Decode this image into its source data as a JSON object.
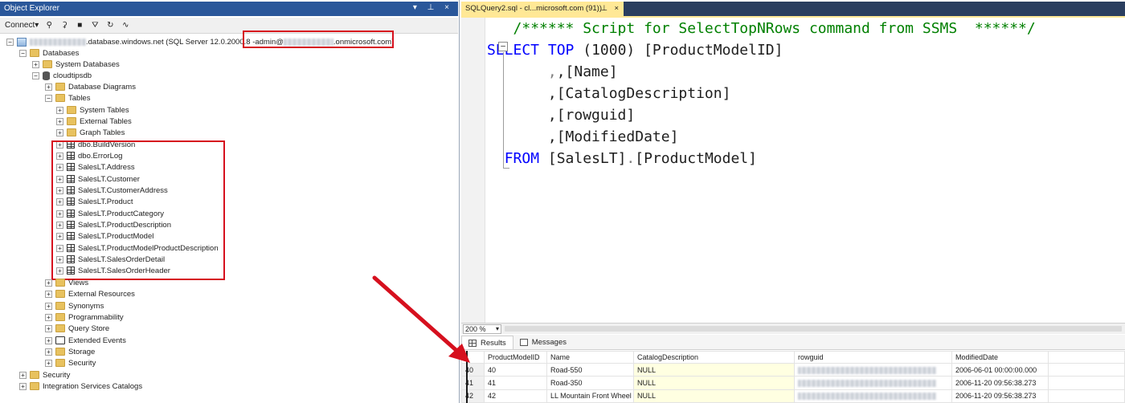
{
  "object_explorer": {
    "title": "Object Explorer",
    "title_buttons": "▾ ⊥ ×",
    "toolbar": {
      "connect_label": "Connect",
      "connect_caret": "▾"
    },
    "server": {
      "name_suffix": ".database.windows.net (SQL Server 12.0.2000.8 - ",
      "user_prefix": "admin@",
      "user_suffix": ".onmicrosoft.com)"
    },
    "databases": "Databases",
    "system_databases": "System Databases",
    "db_name": "cloudtipsdb",
    "database_diagrams": "Database Diagrams",
    "tables": "Tables",
    "table_folders": [
      "System Tables",
      "External Tables",
      "Graph Tables"
    ],
    "table_list": [
      "dbo.BuildVersion",
      "dbo.ErrorLog",
      "SalesLT.Address",
      "SalesLT.Customer",
      "SalesLT.CustomerAddress",
      "SalesLT.Product",
      "SalesLT.ProductCategory",
      "SalesLT.ProductDescription",
      "SalesLT.ProductModel",
      "SalesLT.ProductModelProductDescription",
      "SalesLT.SalesOrderDetail",
      "SalesLT.SalesOrderHeader"
    ],
    "db_folders": [
      "Views",
      "External Resources",
      "Synonyms",
      "Programmability",
      "Query Store",
      "Extended Events",
      "Storage",
      "Security"
    ],
    "server_folders": [
      "Security",
      "Integration Services Catalogs"
    ]
  },
  "editor": {
    "tab_label": "SQLQuery2.sql - cl...microsoft.com (91))",
    "tab_pin": "⊥",
    "tab_close": "×",
    "code": {
      "comment": "/****** Script for SelectTopNRows command from SSMS  ******/",
      "select_kw": "SELECT",
      "top_kw": "TOP",
      "top_arg": " (1000) [ProductModelID]",
      "lines": [
        ",[Name]",
        ",[CatalogDescription]",
        ",[rowguid]",
        ",[ModifiedDate]"
      ],
      "from_kw": "FROM",
      "from_schema": " [SalesLT]",
      "dot": ".",
      "from_table": "[ProductModel]"
    },
    "zoom": "200 %",
    "results_tabs": [
      "Results",
      "Messages"
    ]
  },
  "results": {
    "columns": [
      "ProductModelID",
      "Name",
      "CatalogDescription",
      "rowguid",
      "ModifiedDate"
    ],
    "rows": [
      {
        "n": "40",
        "id": "40",
        "name": "Road-550",
        "catalog": "NULL",
        "modified": "2006-06-01 00:00:00.000"
      },
      {
        "n": "41",
        "id": "41",
        "name": "Road-350",
        "catalog": "NULL",
        "modified": "2006-11-20 09:56:38.273"
      },
      {
        "n": "42",
        "id": "42",
        "name": "LL Mountain Front Wheel",
        "catalog": "NULL",
        "modified": "2006-11-20 09:56:38.273"
      }
    ]
  },
  "colors": {
    "titlebar": "#2a579a",
    "tab_active": "#ffe896",
    "keyword": "#0000ff",
    "comment": "#008000",
    "highlight_red": "#d6101e"
  }
}
